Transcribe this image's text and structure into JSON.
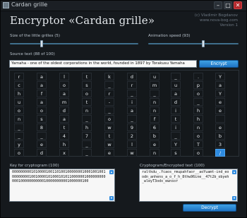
{
  "window": {
    "title": "Cardan grille"
  },
  "header": {
    "title": "Encryptor «Cardan grille»",
    "author_lines": [
      "(c) Vladimir Bogdanov",
      "www.nova-bog.com",
      "Version 1"
    ]
  },
  "controls": {
    "grille_size_label": "Size of the little grilles (5)",
    "grille_size_value": 5,
    "speed_label": "Animation speed (93)",
    "speed_value": 93
  },
  "source": {
    "label": "Source text (88 of 100)",
    "value": "Yamaha - one of the oldest corporations in the world, founded in 1897 by Torakusu Yamaha",
    "encrypt_label": "Encrypt"
  },
  "grid": [
    [
      "r",
      "a",
      "l",
      "t",
      "k",
      "d",
      "u",
      "_",
      ".",
      "Y"
    ],
    [
      "c",
      "a",
      "o",
      "s",
      "_",
      "r",
      "m",
      "u",
      "p",
      "a"
    ],
    [
      "h",
      "f",
      "a",
      "o",
      "r",
      "_",
      "_",
      "a",
      "o",
      "Y"
    ],
    [
      "u",
      "a",
      "m",
      "t",
      "-",
      "i",
      "n",
      "d",
      "_",
      "e"
    ],
    [
      "o",
      "o",
      "d",
      "n",
      "_",
      "a",
      "n",
      "i",
      "h",
      "e"
    ],
    [
      "n",
      "s",
      "a",
      "_",
      "o",
      "_",
      "f",
      "t",
      "h",
      ""
    ],
    [
      "_",
      "8",
      "t",
      "h",
      "w",
      "9",
      "6",
      "i",
      "n",
      "e"
    ],
    [
      "_",
      "_",
      "4",
      "7",
      "t",
      "2",
      "b",
      "_",
      "o",
      "b"
    ],
    [
      "y",
      "e",
      "h",
      "_",
      "w",
      "l",
      "e",
      "Y",
      "T",
      "3"
    ],
    [
      "o",
      "d",
      "x",
      "_",
      "e",
      "w",
      "n",
      "s",
      "o",
      "/"
    ]
  ],
  "selected_cell": {
    "row": 9,
    "col": 9
  },
  "key_panel": {
    "label": "Key for cryptogram (100)",
    "value": "0000000001010000100110100100000001000100100100000000100100001010001010110000001000000000000100000000000100000000001000000100"
  },
  "crypto_panel": {
    "label": "Cryptogram/Encrypted text (100)",
    "value": "raltkdu_.Ycaos_rmupahfaor__aoYuamt-ind_eoodn_anhens_a_o_f_h_8thw96ine__47t2b_obyeh_wleyT3odx_ewnsor",
    "decrypt_label": "Decrypt"
  }
}
